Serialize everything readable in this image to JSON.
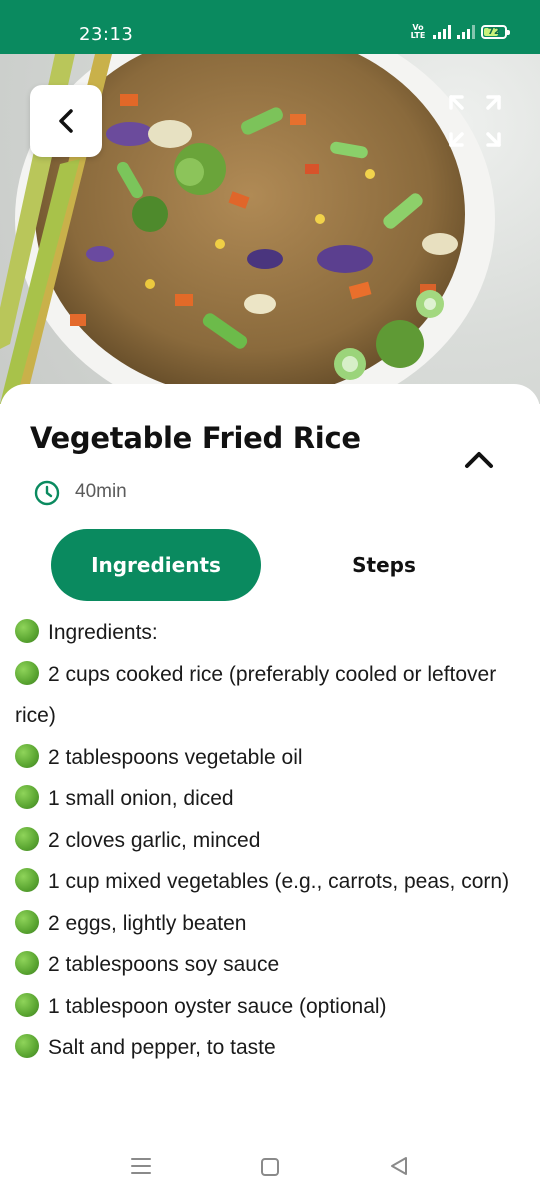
{
  "status_bar": {
    "time": "23:13",
    "network_label": "Vo LTE",
    "battery_level": "72",
    "battery_fraction": 0.72
  },
  "hero": {
    "icons": {
      "back": "chevron-left-icon",
      "expand": "expand-icon"
    }
  },
  "recipe": {
    "title": "Vegetable Fried Rice",
    "duration": "40min",
    "icons": {
      "clock": "clock-icon",
      "collapse": "chevron-up-icon"
    }
  },
  "tabs": [
    {
      "label": "Ingredients",
      "active": true
    },
    {
      "label": "Steps",
      "active": false
    }
  ],
  "ingredients": [
    "Ingredients:",
    "2 cups cooked rice (preferably cooled or leftover rice)",
    "2 tablespoons vegetable oil",
    "1 small onion, diced",
    "2 cloves garlic, minced",
    "1 cup mixed vegetables (e.g., carrots, peas, corn)",
    "2 eggs, lightly beaten",
    "2 tablespoons soy sauce",
    "1 tablespoon oyster sauce (optional)",
    "Salt and pepper, to taste"
  ],
  "nav_bar": {
    "icons": [
      "menu-icon",
      "home-icon",
      "back-triangle-icon"
    ]
  },
  "colors": {
    "brand_green": "#0a8a5f",
    "bullet_green": "#5aa531",
    "title_text": "#111111",
    "muted_text": "#5b5b5b"
  }
}
